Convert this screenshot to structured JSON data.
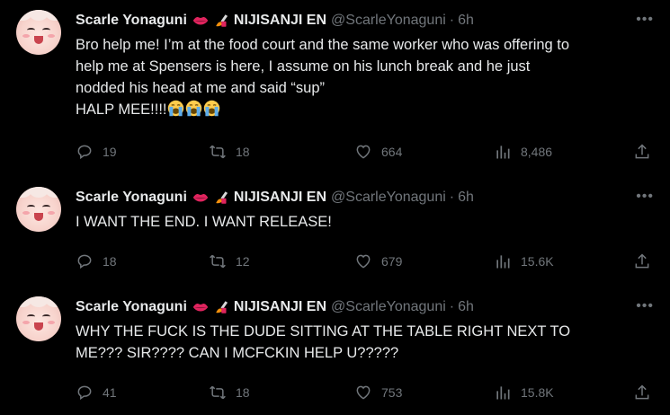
{
  "tweets": [
    {
      "author": "Scarle Yonaguni",
      "affiliation": "NIJISANJI EN",
      "handle": "@ScarleYonaguni",
      "time": "6h",
      "lines": [
        "Bro help me! I’m at the food court and the same worker who was offering to",
        "help me at Spensers is here, I assume on his lunch break and he just",
        "nodded his head at me and said “sup”",
        "HALP MEE!!!!"
      ],
      "replies": "19",
      "retweets": "18",
      "likes": "664",
      "views": "8,486"
    },
    {
      "author": "Scarle Yonaguni",
      "affiliation": "NIJISANJI EN",
      "handle": "@ScarleYonaguni",
      "time": "6h",
      "lines": [
        "I WANT THE END. I WANT RELEASE!"
      ],
      "replies": "18",
      "retweets": "12",
      "likes": "679",
      "views": "15.6K"
    },
    {
      "author": "Scarle Yonaguni",
      "affiliation": "NIJISANJI EN",
      "handle": "@ScarleYonaguni",
      "time": "6h",
      "lines": [
        "WHY THE FUCK IS THE DUDE SITTING AT THE TABLE RIGHT NEXT TO",
        "ME??? SIR???? CAN I MCFCKIN HELP U?????"
      ],
      "replies": "41",
      "retweets": "18",
      "likes": "753",
      "views": "15.8K"
    }
  ],
  "icons": {
    "header": [
      "lips-emoji",
      "nail-polish-emoji"
    ],
    "actions": [
      "reply-icon",
      "retweet-icon",
      "like-icon",
      "views-icon",
      "share-icon"
    ],
    "inline": "crying-face-emoji"
  },
  "colors": {
    "background": "#000000",
    "text": "#e7e9ea",
    "muted": "#71767b"
  }
}
